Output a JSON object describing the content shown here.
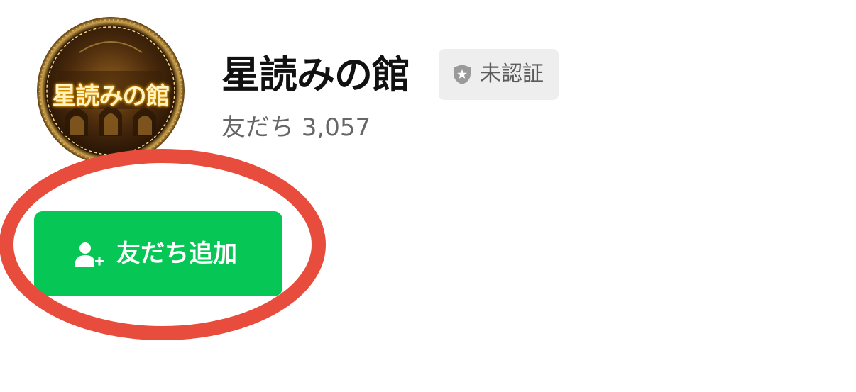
{
  "profile": {
    "avatar_text": "星読みの館",
    "name": "星読みの館",
    "verification_badge": {
      "label": "未認証",
      "icon": "shield-star-icon"
    },
    "friends_label": "友だち 3,057"
  },
  "add_friend_button": {
    "label": "友だち追加",
    "icon": "person-add-icon"
  },
  "colors": {
    "accent_green": "#06c755",
    "highlight_red": "#e74c3c",
    "badge_bg": "#eeeeee"
  }
}
